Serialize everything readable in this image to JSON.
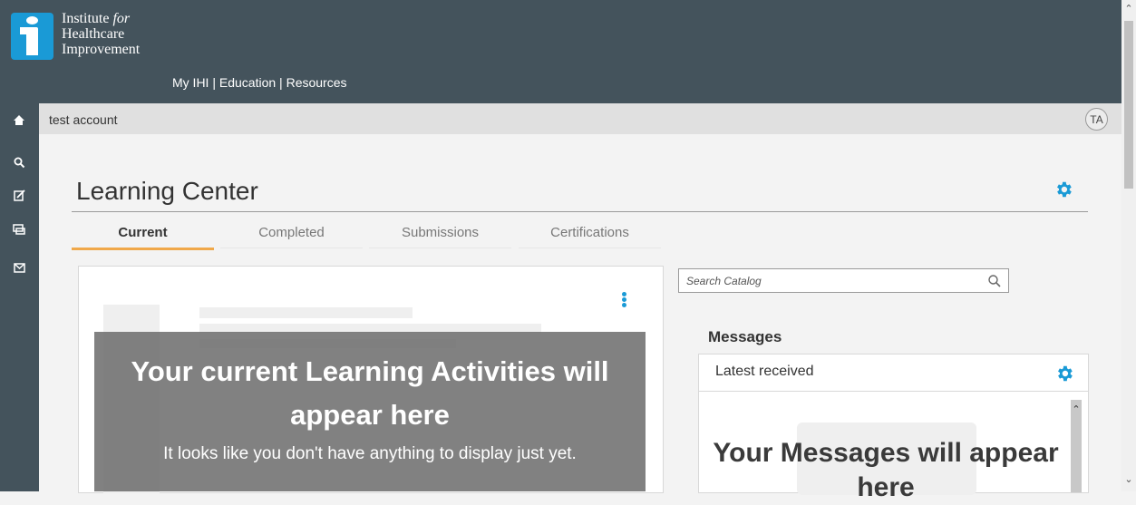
{
  "brand": {
    "line1": "Institute ",
    "line1_italic": "for",
    "line2": "Healthcare",
    "line3": "Improvement"
  },
  "topnav": {
    "my_ihi": "My IHI",
    "sep1": " | ",
    "education": "Education",
    "sep2": " | ",
    "resources": "Resources"
  },
  "account": {
    "name": "test account",
    "initials": "TA"
  },
  "sidebar": {
    "items": [
      {
        "icon": "home-icon"
      },
      {
        "icon": "search-icon"
      },
      {
        "icon": "edit-icon"
      },
      {
        "icon": "chat-icon"
      },
      {
        "icon": "mail-icon"
      }
    ]
  },
  "page": {
    "title": "Learning Center"
  },
  "tabs": [
    {
      "label": "Current",
      "active": true
    },
    {
      "label": "Completed",
      "active": false
    },
    {
      "label": "Submissions",
      "active": false
    },
    {
      "label": "Certifications",
      "active": false
    }
  ],
  "activities": {
    "empty_title": "Your current Learning Activities will appear here",
    "empty_subtitle": "It looks like you don't have anything to display just yet."
  },
  "search": {
    "placeholder": "Search Catalog"
  },
  "messages": {
    "title": "Messages",
    "header": "Latest received",
    "empty_title": "Your Messages will appear here"
  },
  "colors": {
    "header_bg": "#44535c",
    "accent_blue": "#1a9ad6",
    "active_tab_underline": "#f0a84a"
  }
}
